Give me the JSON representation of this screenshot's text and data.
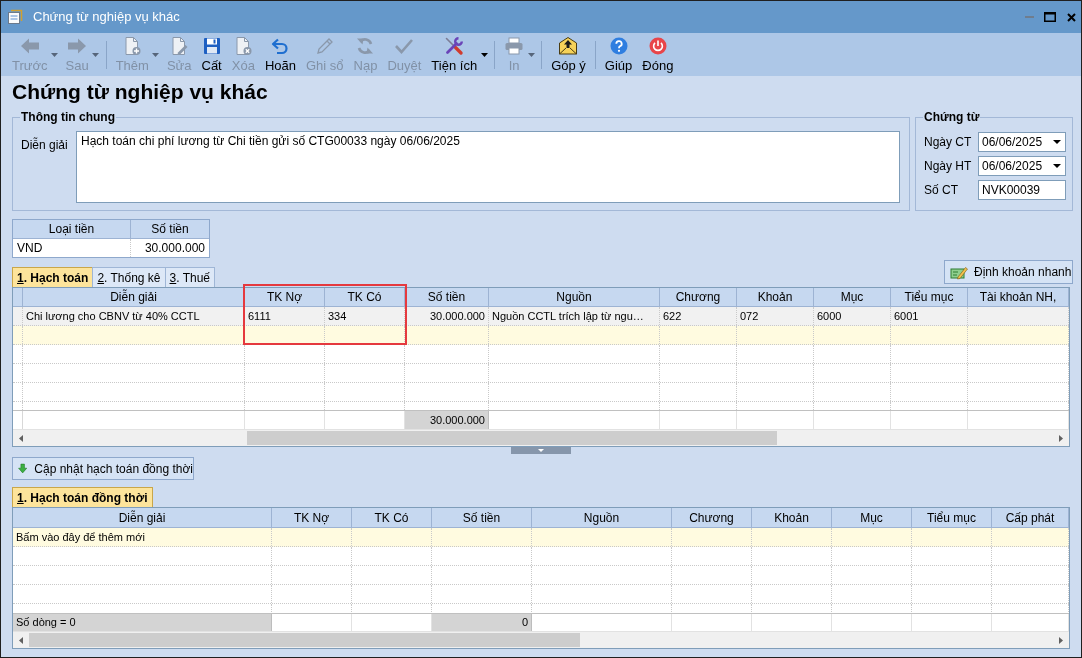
{
  "window": {
    "title": "Chứng từ nghiệp vụ khác",
    "minimize_disabled": true
  },
  "toolbar": [
    [
      {
        "label": "Trước",
        "disabled": true,
        "dropdown": true
      },
      {
        "label": "Sau",
        "disabled": true,
        "dropdown": true
      }
    ],
    [
      {
        "label": "Thêm",
        "disabled": true,
        "dropdown": true
      },
      {
        "label": "Sửa",
        "disabled": true,
        "dropdown": false
      },
      {
        "label": "Cất",
        "disabled": false,
        "dropdown": false
      },
      {
        "label": "Xóa",
        "disabled": true,
        "dropdown": false
      },
      {
        "label": "Hoãn",
        "disabled": false,
        "dropdown": false
      },
      {
        "label": "Ghi sổ",
        "disabled": true,
        "dropdown": false
      },
      {
        "label": "Nạp",
        "disabled": true,
        "dropdown": false
      },
      {
        "label": "Duyệt",
        "disabled": true,
        "dropdown": false
      },
      {
        "label": "Tiện ích",
        "disabled": false,
        "dropdown": true
      }
    ],
    [
      {
        "label": "In",
        "disabled": true,
        "dropdown": true
      }
    ],
    [
      {
        "label": "Góp ý",
        "disabled": false,
        "dropdown": false
      }
    ],
    [
      {
        "label": "Giúp",
        "disabled": false,
        "dropdown": false
      },
      {
        "label": "Đóng",
        "disabled": false,
        "dropdown": false
      }
    ]
  ],
  "heading": "Chứng từ nghiệp vụ khác",
  "general_info": {
    "title": "Thông tin chung",
    "label": "Diễn giải",
    "value": "Hạch toán chi phí lương từ Chi tiền gửi số CTG00033 ngày 06/06/2025"
  },
  "voucher": {
    "title": "Chứng từ",
    "fields": [
      {
        "label": "Ngày CT",
        "value": "06/06/2025",
        "kind": "date"
      },
      {
        "label": "Ngày HT",
        "value": "06/06/2025",
        "kind": "date"
      },
      {
        "label": "Số CT",
        "value": "NVK00039",
        "kind": "text"
      }
    ]
  },
  "currency": {
    "columns": [
      "Loại tiền",
      "Số tiền"
    ],
    "rows": [
      [
        "VND",
        "30.000.000"
      ]
    ]
  },
  "tabs": [
    {
      "label": "1. Hạch toán",
      "selected": true
    },
    {
      "label": "2. Thống kê",
      "selected": false
    },
    {
      "label": "3. Thuế",
      "selected": false
    }
  ],
  "quick_entry_button": "Định khoản nhanh",
  "entries": {
    "columns": [
      {
        "label": "Diễn giải",
        "kind": "text",
        "highlighted": false
      },
      {
        "label": "TK Nợ",
        "kind": "text",
        "highlighted": true
      },
      {
        "label": "TK Có",
        "kind": "text",
        "highlighted": true
      },
      {
        "label": "Số tiền",
        "kind": "amount",
        "highlighted": false,
        "summary": "30.000.000"
      },
      {
        "label": "Nguồn",
        "kind": "text",
        "highlighted": false
      },
      {
        "label": "Chương",
        "kind": "text",
        "highlighted": false
      },
      {
        "label": "Khoản",
        "kind": "text",
        "highlighted": false
      },
      {
        "label": "Mục",
        "kind": "text",
        "highlighted": false
      },
      {
        "label": "Tiểu mục",
        "kind": "text",
        "highlighted": false
      },
      {
        "label": "Tài khoản NH,",
        "kind": "text",
        "highlighted": false
      }
    ],
    "rows": [
      {
        "selected": true,
        "cells": [
          "Chi lương cho CBNV từ 40% CCTL",
          "6111",
          "334",
          "30.000.000",
          "Nguồn CCTL trích lập từ ngu…",
          "622",
          "072",
          "6000",
          "6001"
        ]
      }
    ],
    "new_row": true
  },
  "update_button": "Cập nhật hạch toán đồng thời",
  "sub_tabs": [
    {
      "label": "1. Hạch toán đồng thời",
      "selected": true
    }
  ],
  "simultaneous": {
    "columns": [
      {
        "label": "Diễn giải",
        "kind": "text",
        "summary": "Số dòng = 0"
      },
      {
        "label": "TK Nợ"
      },
      {
        "label": "TK Có"
      },
      {
        "label": "Số tiền",
        "kind": "amount",
        "summary": "0"
      },
      {
        "label": "Nguồn"
      },
      {
        "label": "Chương"
      },
      {
        "label": "Khoản"
      },
      {
        "label": "Mục"
      },
      {
        "label": "Tiểu mục"
      },
      {
        "label": "Cấp phát"
      }
    ],
    "new_row": true,
    "new_row_hint": "Bấm vào đây để thêm mới"
  }
}
